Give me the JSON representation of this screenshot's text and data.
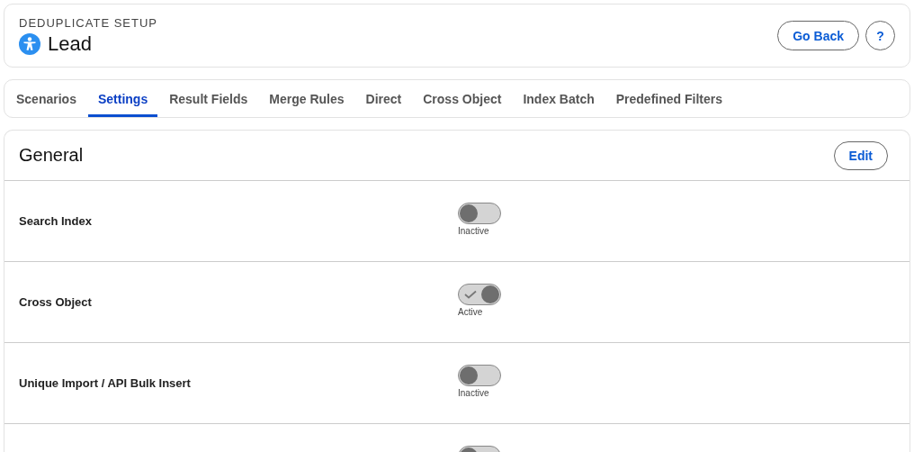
{
  "header": {
    "eyebrow": "DEDUPLICATE SETUP",
    "title": "Lead",
    "buttons": [
      {
        "kind": "text",
        "label": "Go Back"
      },
      {
        "kind": "help",
        "label": "?"
      }
    ]
  },
  "tabs": [
    {
      "label": "Scenarios",
      "selected": false
    },
    {
      "label": "Settings",
      "selected": true
    },
    {
      "label": "Result Fields",
      "selected": false
    },
    {
      "label": "Merge Rules",
      "selected": false
    },
    {
      "label": "Direct",
      "selected": false
    },
    {
      "label": "Cross Object",
      "selected": false
    },
    {
      "label": "Index Batch",
      "selected": false
    },
    {
      "label": "Predefined Filters",
      "selected": false
    }
  ],
  "section": {
    "title": "General",
    "edit_button": "Edit",
    "settings": [
      {
        "label": "Search Index",
        "on": false,
        "status": "Inactive"
      },
      {
        "label": "Cross Object",
        "on": true,
        "status": "Active"
      },
      {
        "label": "Unique Import / API Bulk Insert",
        "on": false,
        "status": "Inactive"
      },
      {
        "on": false
      }
    ]
  }
}
